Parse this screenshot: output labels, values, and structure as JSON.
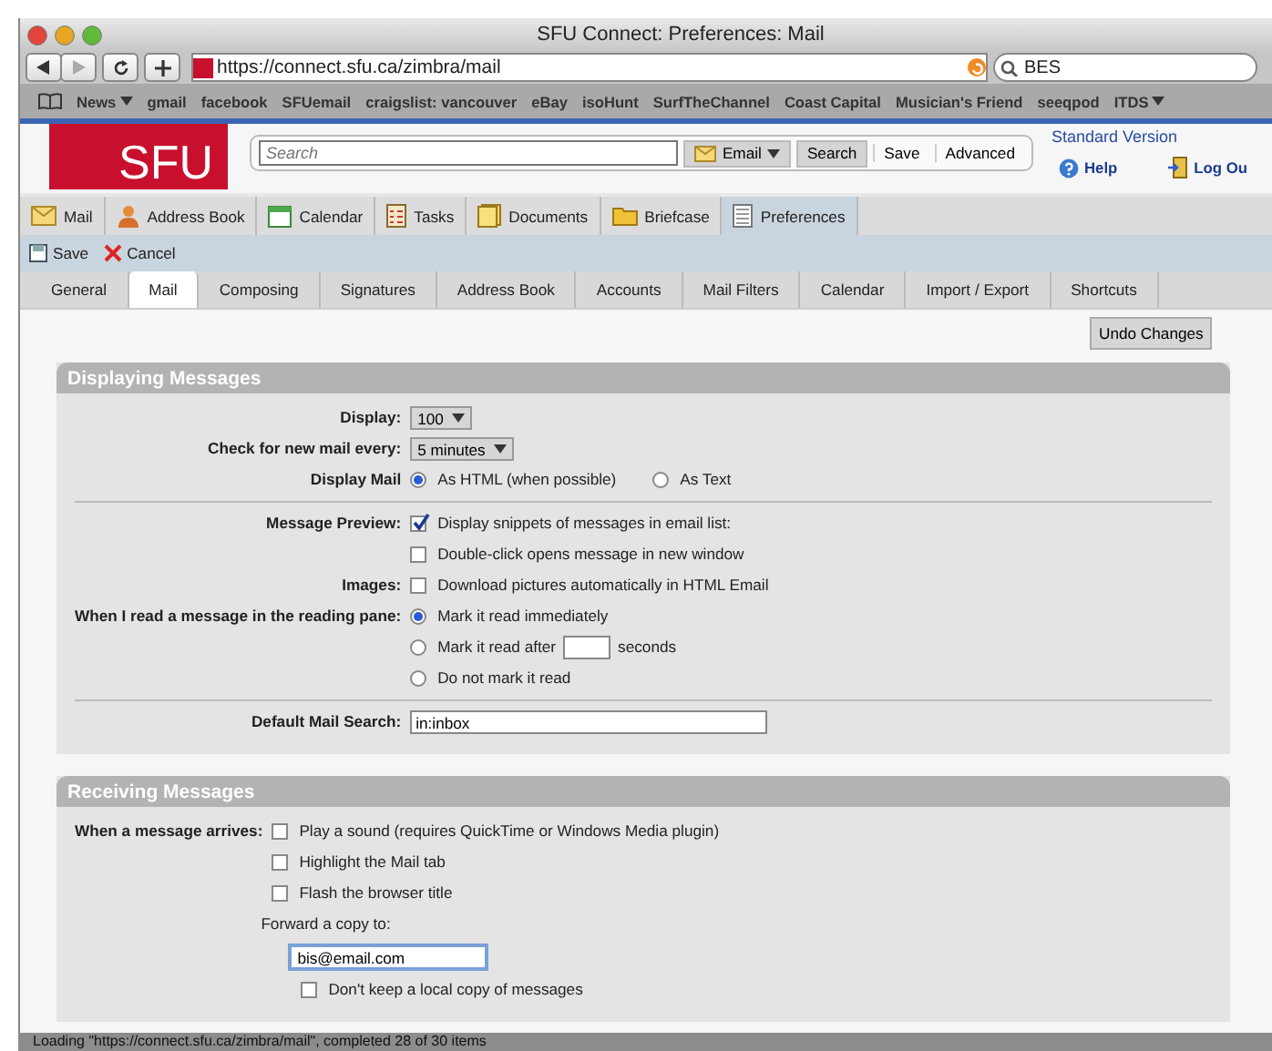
{
  "window": {
    "title": "SFU Connect: Preferences: Mail"
  },
  "browser": {
    "url": "https://connect.sfu.ca/zimbra/mail",
    "search_value": "BES"
  },
  "bookmarks": [
    {
      "label": "News",
      "menu": true
    },
    {
      "label": "gmail",
      "menu": false
    },
    {
      "label": "facebook",
      "menu": false
    },
    {
      "label": "SFUemail",
      "menu": false
    },
    {
      "label": "craigslist: vancouver",
      "menu": false
    },
    {
      "label": "eBay",
      "menu": false
    },
    {
      "label": "isoHunt",
      "menu": false
    },
    {
      "label": "SurfTheChannel",
      "menu": false
    },
    {
      "label": "Coast Capital",
      "menu": false
    },
    {
      "label": "Musician's Friend",
      "menu": false
    },
    {
      "label": "seeqpod",
      "menu": false
    },
    {
      "label": "ITDS",
      "menu": true
    }
  ],
  "header": {
    "logo": "SFU",
    "search": {
      "placeholder": "Search"
    },
    "search_type": "Email",
    "buttons": [
      "Search",
      "Save",
      "Advanced"
    ],
    "standard_version": "Standard Version",
    "help": "Help",
    "logout": "Log Ou"
  },
  "app_tabs": [
    {
      "label": "Mail",
      "selected": false
    },
    {
      "label": "Address Book",
      "selected": false
    },
    {
      "label": "Calendar",
      "selected": false
    },
    {
      "label": "Tasks",
      "selected": false
    },
    {
      "label": "Documents",
      "selected": false
    },
    {
      "label": "Briefcase",
      "selected": false
    },
    {
      "label": "Preferences",
      "selected": true
    }
  ],
  "toolbar": [
    "Save",
    "Cancel"
  ],
  "pref_tabs": [
    {
      "label": "General",
      "selected": false
    },
    {
      "label": "Mail",
      "selected": true
    },
    {
      "label": "Composing",
      "selected": false
    },
    {
      "label": "Signatures",
      "selected": false
    },
    {
      "label": "Address Book",
      "selected": false
    },
    {
      "label": "Accounts",
      "selected": false
    },
    {
      "label": "Mail Filters",
      "selected": false
    },
    {
      "label": "Calendar",
      "selected": false
    },
    {
      "label": "Import / Export",
      "selected": false
    },
    {
      "label": "Shortcuts",
      "selected": false
    }
  ],
  "undo_button": "Undo Changes",
  "sections": [
    {
      "title": "Displaying Messages",
      "rows": [
        {
          "kind": "select",
          "label": "Display:",
          "value": "100"
        },
        {
          "kind": "select",
          "label": "Check for new mail every:",
          "value": "5 minutes"
        },
        {
          "kind": "radio_row",
          "label": "Display Mail",
          "options": [
            {
              "label": "As HTML (when possible)",
              "selected": true
            },
            {
              "label": "As Text",
              "selected": false
            }
          ]
        },
        {
          "kind": "divider"
        },
        {
          "kind": "checkboxes",
          "label": "Message Preview:",
          "options": [
            {
              "label": "Display snippets of messages in email list:",
              "checked": true
            },
            {
              "label": "Double-click opens message in new window",
              "checked": false
            }
          ]
        },
        {
          "kind": "checkboxes",
          "label": "Images:",
          "options": [
            {
              "label": "Download pictures automatically in HTML Email",
              "checked": false
            }
          ]
        },
        {
          "kind": "radio_list",
          "label": "When I read a message in the reading pane:",
          "options": [
            {
              "label": "Mark it read immediately",
              "selected": true
            },
            {
              "label": "Mark it read after",
              "suffix": "seconds",
              "selected": false
            },
            {
              "label": "Do not mark it read",
              "selected": false
            }
          ]
        },
        {
          "kind": "divider"
        },
        {
          "kind": "text",
          "label": "Default Mail Search:",
          "value": "in:inbox"
        }
      ]
    },
    {
      "title": "Receiving Messages",
      "rows": [
        {
          "kind": "checkboxes",
          "label": "When a message arrives:",
          "options": [
            {
              "label": "Play a sound (requires QuickTime or Windows Media plugin)",
              "checked": false
            },
            {
              "label": "Highlight the Mail tab",
              "checked": false
            },
            {
              "label": "Flash the browser title",
              "checked": false
            }
          ]
        },
        {
          "kind": "forward",
          "label": "Forward a copy to:",
          "value": "bis@email.com",
          "option": {
            "label": "Don't keep a local copy of messages",
            "checked": false
          }
        }
      ]
    }
  ],
  "status_bar": "Loading \"https://connect.sfu.ca/zimbra/mail\", completed 28 of 30 items"
}
